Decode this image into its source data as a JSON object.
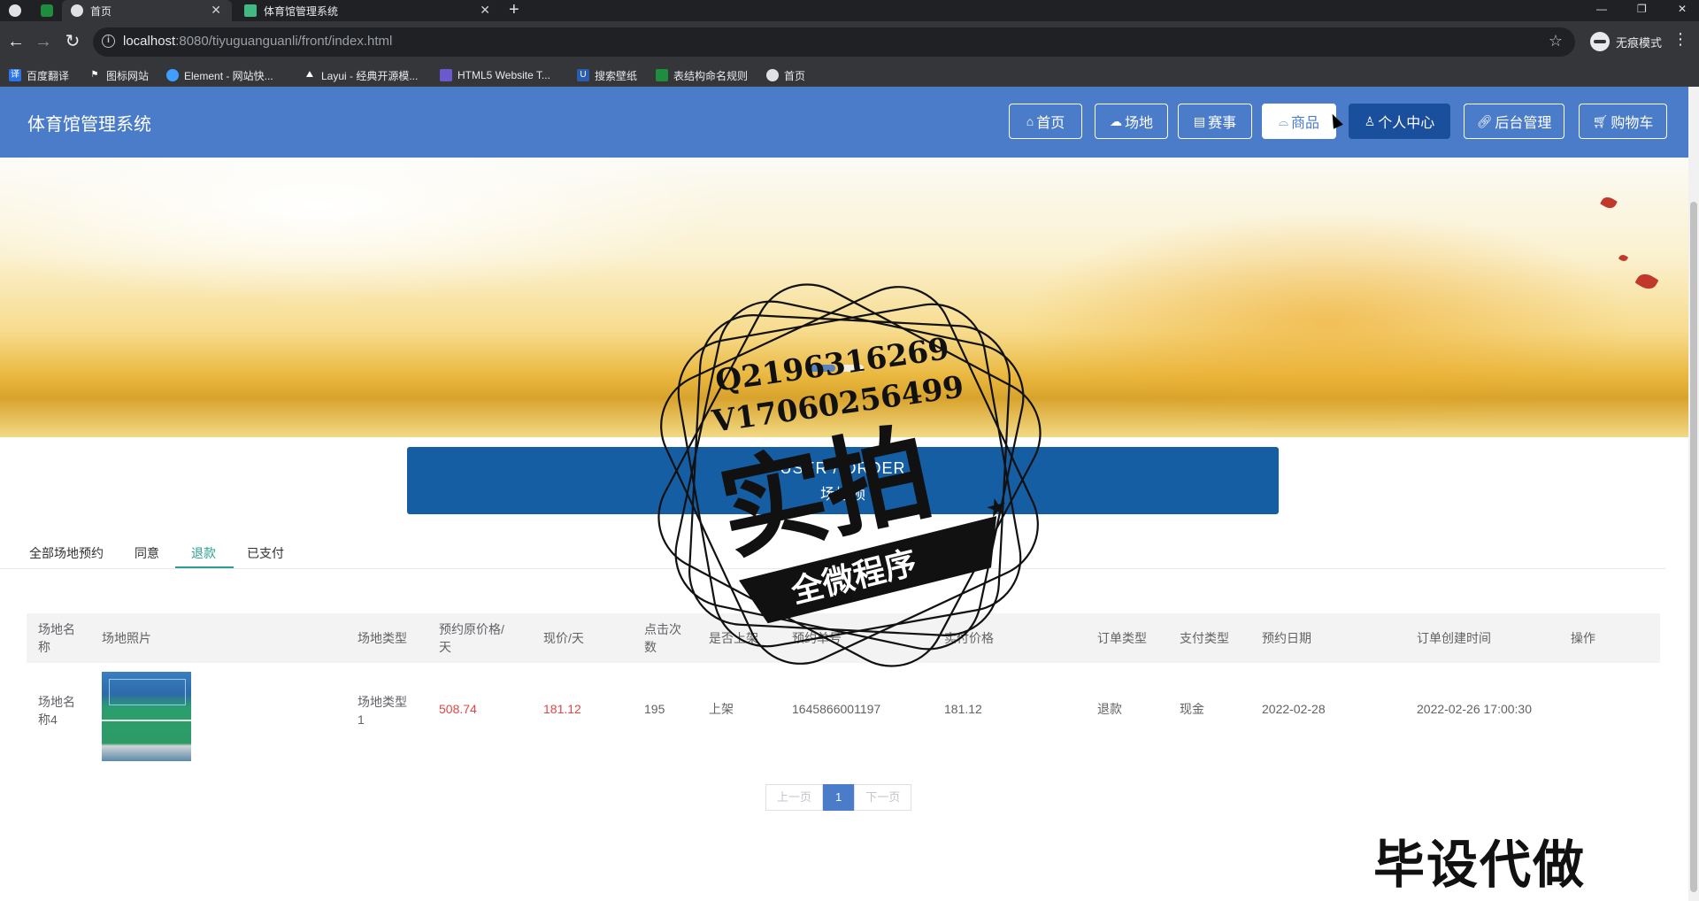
{
  "browser": {
    "tabs": [
      {
        "label": "",
        "icon": "globe-icon"
      },
      {
        "label": "",
        "icon": "sheet-icon"
      },
      {
        "label": "首页",
        "icon": "globe-icon"
      },
      {
        "label": "体育馆管理系统",
        "icon": "vue-icon"
      }
    ],
    "url_host": "localhost",
    "url_rest": ":8080/tiyuguanguanli/front/index.html",
    "incognito_label": "无痕模式",
    "bookmarks": [
      "百度翻译",
      "图标网站",
      "Element - 网站快...",
      "Layui - 经典开源模...",
      "HTML5 Website T...",
      "搜索壁纸",
      "表结构命名规则",
      "首页"
    ]
  },
  "header": {
    "title": "体育馆管理系统",
    "nav": [
      {
        "label": "首页",
        "icon": "home-icon"
      },
      {
        "label": "场地",
        "icon": "venue-icon"
      },
      {
        "label": "赛事",
        "icon": "calendar-icon"
      },
      {
        "label": "商品",
        "icon": "shop-icon"
      },
      {
        "label": "个人中心",
        "icon": "user-icon"
      },
      {
        "label": "后台管理",
        "icon": "link-icon"
      },
      {
        "label": "购物车",
        "icon": "cart-icon"
      }
    ]
  },
  "subbar": {
    "en": "USER / ORDER",
    "cn": "场地预"
  },
  "tabs": [
    "全部场地预约",
    "同意",
    "退款",
    "已支付"
  ],
  "active_tab": "退款",
  "table": {
    "headers": [
      "场地名称",
      "场地照片",
      "场地类型",
      "预约原价格/天",
      "现价/天",
      "点击次数",
      "是否上架",
      "预约单号",
      "实付价格",
      "订单类型",
      "支付类型",
      "预约日期",
      "订单创建时间",
      "操作"
    ],
    "rows": [
      {
        "name": "场地名称4",
        "type": "场地类型1",
        "orig_price": "508.74",
        "price": "181.12",
        "clicks": "195",
        "on_shelf": "上架",
        "order_no": "1645866001197",
        "paid": "181.12",
        "order_type": "退款",
        "pay_type": "现金",
        "book_date": "2022-02-28",
        "created": "2022-02-26 17:00:30"
      }
    ]
  },
  "pager": {
    "prev": "上一页",
    "current": "1",
    "next": "下一页"
  },
  "watermark": {
    "line1": "Q2196316269",
    "line2": "V17060256499",
    "big": "实拍",
    "ribbon": "全微程序",
    "corner": "毕设代做"
  },
  "colors": {
    "header": "#4a7cc9",
    "subbar": "#155ea4",
    "accent": "#2b9e8f",
    "price_red": "#e04646"
  }
}
